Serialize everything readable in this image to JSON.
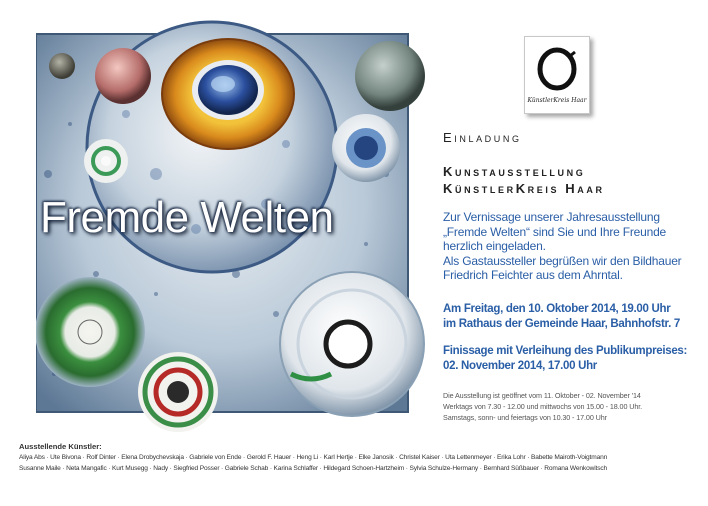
{
  "artwork": {
    "title": "Fremde Welten"
  },
  "logo": {
    "text": "KünstlerKreis Haar",
    "icon": "ring-brushstroke-icon"
  },
  "headings": {
    "invitation": "Einladung",
    "line1": "Kunstausstellung",
    "line2": "KünstlerKreis Haar"
  },
  "intro": {
    "lines": [
      "Zur Vernissage unserer Jahresausstellung",
      "„Fremde Welten“ sind Sie und Ihre Freunde",
      "herzlich eingeladen.",
      "Als Gastaussteller begrüßen wir den Bildhauer",
      "Friedrich Feichter aus dem Ahrntal."
    ]
  },
  "vernissage": {
    "lines": [
      "Am Freitag, den 10. Oktober 2014, 19.00 Uhr",
      "im Rathaus der Gemeinde Haar, Bahnhofstr. 7"
    ]
  },
  "finissage": {
    "lines": [
      "Finissage mit Verleihung des Publikumpreises:",
      "02. November 2014, 17.00 Uhr"
    ]
  },
  "hours": {
    "lines": [
      "Die Ausstellung ist geöffnet vom 11. Oktober - 02. November '14",
      "Werktags von 7.30 - 12.00 und mittwochs von 15.00 - 18.00 Uhr.",
      "Samstags, sonn- und feiertags von 10.30 - 17.00 Uhr"
    ]
  },
  "artists": {
    "heading": "Ausstellende Künstler:",
    "lines": [
      "Aliya Abs · Ute Bivona · Rolf Dinter · Elena Drobychevskaja · Gabriele von Ende · Gerold F. Hauer · Heng Li · Karl Hertje · Elke Janosik · Christel Kaiser · Uta Lettenmeyer · Erika Lohr · Babette Mairoth-Voigtmann",
      "Susanne Maile · Neta Mangafic · Kurt Musegg · Nady · Siegfried Posser · Gabriele Schab · Karina Schlaffer · Hildegard Schoen-Hartzheim · Sylvia Schulze-Hermany · Bernhard Süßbauer · Romana Wenkowitsch"
    ]
  },
  "colors": {
    "accent_blue": "#2a5ea6",
    "heading_text": "#222222",
    "hours_text": "#555555"
  }
}
